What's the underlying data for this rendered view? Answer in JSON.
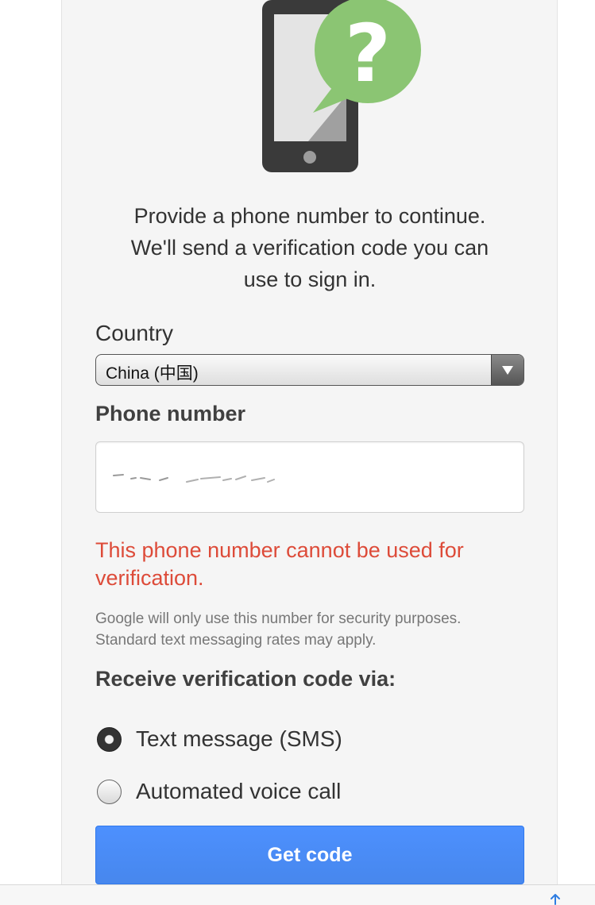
{
  "intro": {
    "message": "Provide a phone number to continue. We'll send a verification code you can use to sign in."
  },
  "country": {
    "label": "Country",
    "selected": "China (中国)"
  },
  "phone": {
    "label": "Phone number",
    "value": ""
  },
  "error": {
    "message": "This phone number cannot be used for verification."
  },
  "note": {
    "message": "Google will only use this number for security purposes. Standard text messaging rates may apply."
  },
  "method": {
    "heading": "Receive verification code via:",
    "options": [
      {
        "label": "Text message (SMS)",
        "checked": true
      },
      {
        "label": "Automated voice call",
        "checked": false
      }
    ]
  },
  "submit": {
    "label": "Get code"
  },
  "colors": {
    "error": "#dd4b39",
    "primary_button": "#4d90fe",
    "speech_bubble": "#8bc573"
  },
  "icons": {
    "illustration": "phone-question-icon",
    "dropdown": "chevron-down-icon",
    "share": "share-icon"
  }
}
